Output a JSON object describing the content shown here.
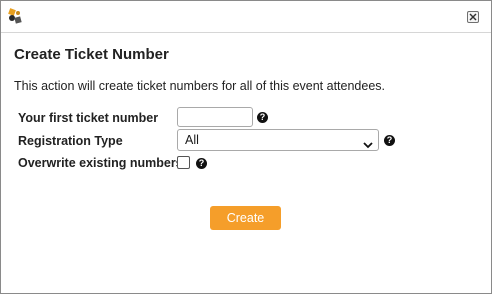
{
  "window": {
    "app_icon": "ticket-app-icon",
    "close_icon": "close-icon"
  },
  "dialog": {
    "title": "Create Ticket Number",
    "description": "This action will create ticket numbers for all of this event attendees."
  },
  "form": {
    "first_ticket": {
      "label": "Your first ticket number",
      "value": "",
      "help_icon": "help-icon"
    },
    "registration_type": {
      "label": "Registration Type",
      "selected": "All",
      "help_icon": "help-icon"
    },
    "overwrite": {
      "label": "Overwrite existing numbers",
      "checked": false,
      "help_icon": "help-icon"
    }
  },
  "actions": {
    "create_label": "Create"
  },
  "colors": {
    "accent": "#f59e2a",
    "border": "#8a8a8a"
  }
}
